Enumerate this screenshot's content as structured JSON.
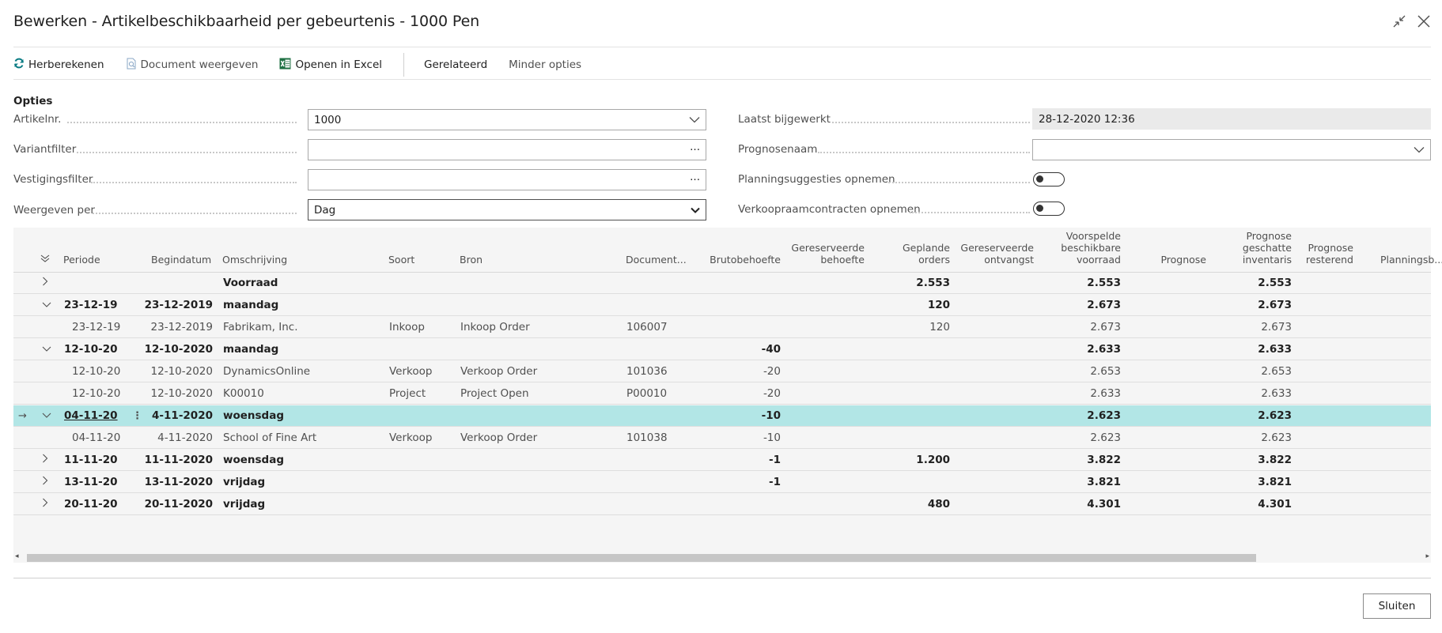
{
  "window": {
    "title": "Bewerken - Artikelbeschikbaarheid per gebeurtenis - 1000 Pen",
    "collapse_icon": "collapse-icon",
    "close_icon": "close-icon"
  },
  "toolbar": {
    "herberekenen": "Herberekenen",
    "document_weergeven": "Document weergeven",
    "openen_in_excel": "Openen in Excel",
    "gerelateerd": "Gerelateerd",
    "minder_opties": "Minder opties"
  },
  "options": {
    "section_title": "Opties",
    "artikelnr_label": "Artikelnr.",
    "artikelnr_value": "1000",
    "variantfilter_label": "Variantfilter",
    "variantfilter_value": "",
    "vestigingsfilter_label": "Vestigingsfilter",
    "vestigingsfilter_value": "",
    "weergeven_per_label": "Weergeven per",
    "weergeven_per_value": "Dag",
    "laatst_bijgewerkt_label": "Laatst bijgewerkt",
    "laatst_bijgewerkt_value": "28-12-2020 12:36",
    "prognosenaam_label": "Prognosenaam",
    "prognosenaam_value": "",
    "planningsuggesties_label": "Planningsuggesties opnemen",
    "planningsuggesties_on": false,
    "verkoopraam_label": "Verkoopraamcontracten opnemen",
    "verkoopraam_on": false,
    "ellipsis": "···"
  },
  "table": {
    "columns": {
      "periode": "Periode",
      "begindatum": "Begindatum",
      "omschrijving": "Omschrijving",
      "soort": "Soort",
      "bron": "Bron",
      "document": "Document...",
      "brutobehoefte": "Brutobehoefte",
      "gereserveerde_behoefte_1": "Gereserveerde",
      "gereserveerde_behoefte_2": "behoefte",
      "geplande_orders_1": "Geplande",
      "geplande_orders_2": "orders",
      "gereserveerde_ontvangst_1": "Gereserveerde",
      "gereserveerde_ontvangst_2": "ontvangst",
      "voorspelde_1": "Voorspelde",
      "voorspelde_2": "beschikbare",
      "voorspelde_3": "voorraad",
      "prognose": "Prognose",
      "prognose_geschatte_1": "Prognose",
      "prognose_geschatte_2": "geschatte",
      "prognose_geschatte_3": "inventaris",
      "prognose_resterend_1": "Prognose",
      "prognose_resterend_2": "resterend",
      "planningsb": "Planningsb..."
    },
    "rows": [
      {
        "periode": "",
        "begindatum": "",
        "omschrijving": "Voorraad",
        "soort": "",
        "bron": "",
        "document": "",
        "bruto": "",
        "geplande": "2.553",
        "voorspelde": "2.553",
        "geschatte": "2.553"
      },
      {
        "periode": "23-12-19",
        "begindatum": "23-12-2019",
        "omschrijving": "maandag",
        "soort": "",
        "bron": "",
        "document": "",
        "bruto": "",
        "geplande": "120",
        "voorspelde": "2.673",
        "geschatte": "2.673"
      },
      {
        "periode": "23-12-19",
        "begindatum": "23-12-2019",
        "omschrijving": "Fabrikam, Inc.",
        "soort": "Inkoop",
        "bron": "Inkoop Order",
        "document": "106007",
        "bruto": "",
        "geplande": "120",
        "voorspelde": "2.673",
        "geschatte": "2.673"
      },
      {
        "periode": "12-10-20",
        "begindatum": "12-10-2020",
        "omschrijving": "maandag",
        "soort": "",
        "bron": "",
        "document": "",
        "bruto": "-40",
        "geplande": "",
        "voorspelde": "2.633",
        "geschatte": "2.633"
      },
      {
        "periode": "12-10-20",
        "begindatum": "12-10-2020",
        "omschrijving": "DynamicsOnline",
        "soort": "Verkoop",
        "bron": "Verkoop Order",
        "document": "101036",
        "bruto": "-20",
        "geplande": "",
        "voorspelde": "2.653",
        "geschatte": "2.653"
      },
      {
        "periode": "12-10-20",
        "begindatum": "12-10-2020",
        "omschrijving": "K00010",
        "soort": "Project",
        "bron": "Project Open",
        "document": "P00010",
        "bruto": "-20",
        "geplande": "",
        "voorspelde": "2.633",
        "geschatte": "2.633"
      },
      {
        "periode": "04-11-20",
        "begindatum": "4-11-2020",
        "omschrijving": "woensdag",
        "soort": "",
        "bron": "",
        "document": "",
        "bruto": "-10",
        "geplande": "",
        "voorspelde": "2.623",
        "geschatte": "2.623"
      },
      {
        "periode": "04-11-20",
        "begindatum": "4-11-2020",
        "omschrijving": "School of Fine Art",
        "soort": "Verkoop",
        "bron": "Verkoop Order",
        "document": "101038",
        "bruto": "-10",
        "geplande": "",
        "voorspelde": "2.623",
        "geschatte": "2.623"
      },
      {
        "periode": "11-11-20",
        "begindatum": "11-11-2020",
        "omschrijving": "woensdag",
        "soort": "",
        "bron": "",
        "document": "",
        "bruto": "-1",
        "geplande": "1.200",
        "voorspelde": "3.822",
        "geschatte": "3.822"
      },
      {
        "periode": "13-11-20",
        "begindatum": "13-11-2020",
        "omschrijving": "vrijdag",
        "soort": "",
        "bron": "",
        "document": "",
        "bruto": "-1",
        "geplande": "",
        "voorspelde": "3.821",
        "geschatte": "3.821"
      },
      {
        "periode": "20-11-20",
        "begindatum": "20-11-2020",
        "omschrijving": "vrijdag",
        "soort": "",
        "bron": "",
        "document": "",
        "bruto": "",
        "geplande": "480",
        "voorspelde": "4.301",
        "geschatte": "4.301"
      }
    ],
    "row_menu_glyph": "⋮"
  },
  "footer": {
    "sluiten": "Sluiten"
  },
  "colors": {
    "selected_row": "#b2e6e6",
    "excel_green": "#1d6f42",
    "refresh_teal": "#0a7b83"
  }
}
